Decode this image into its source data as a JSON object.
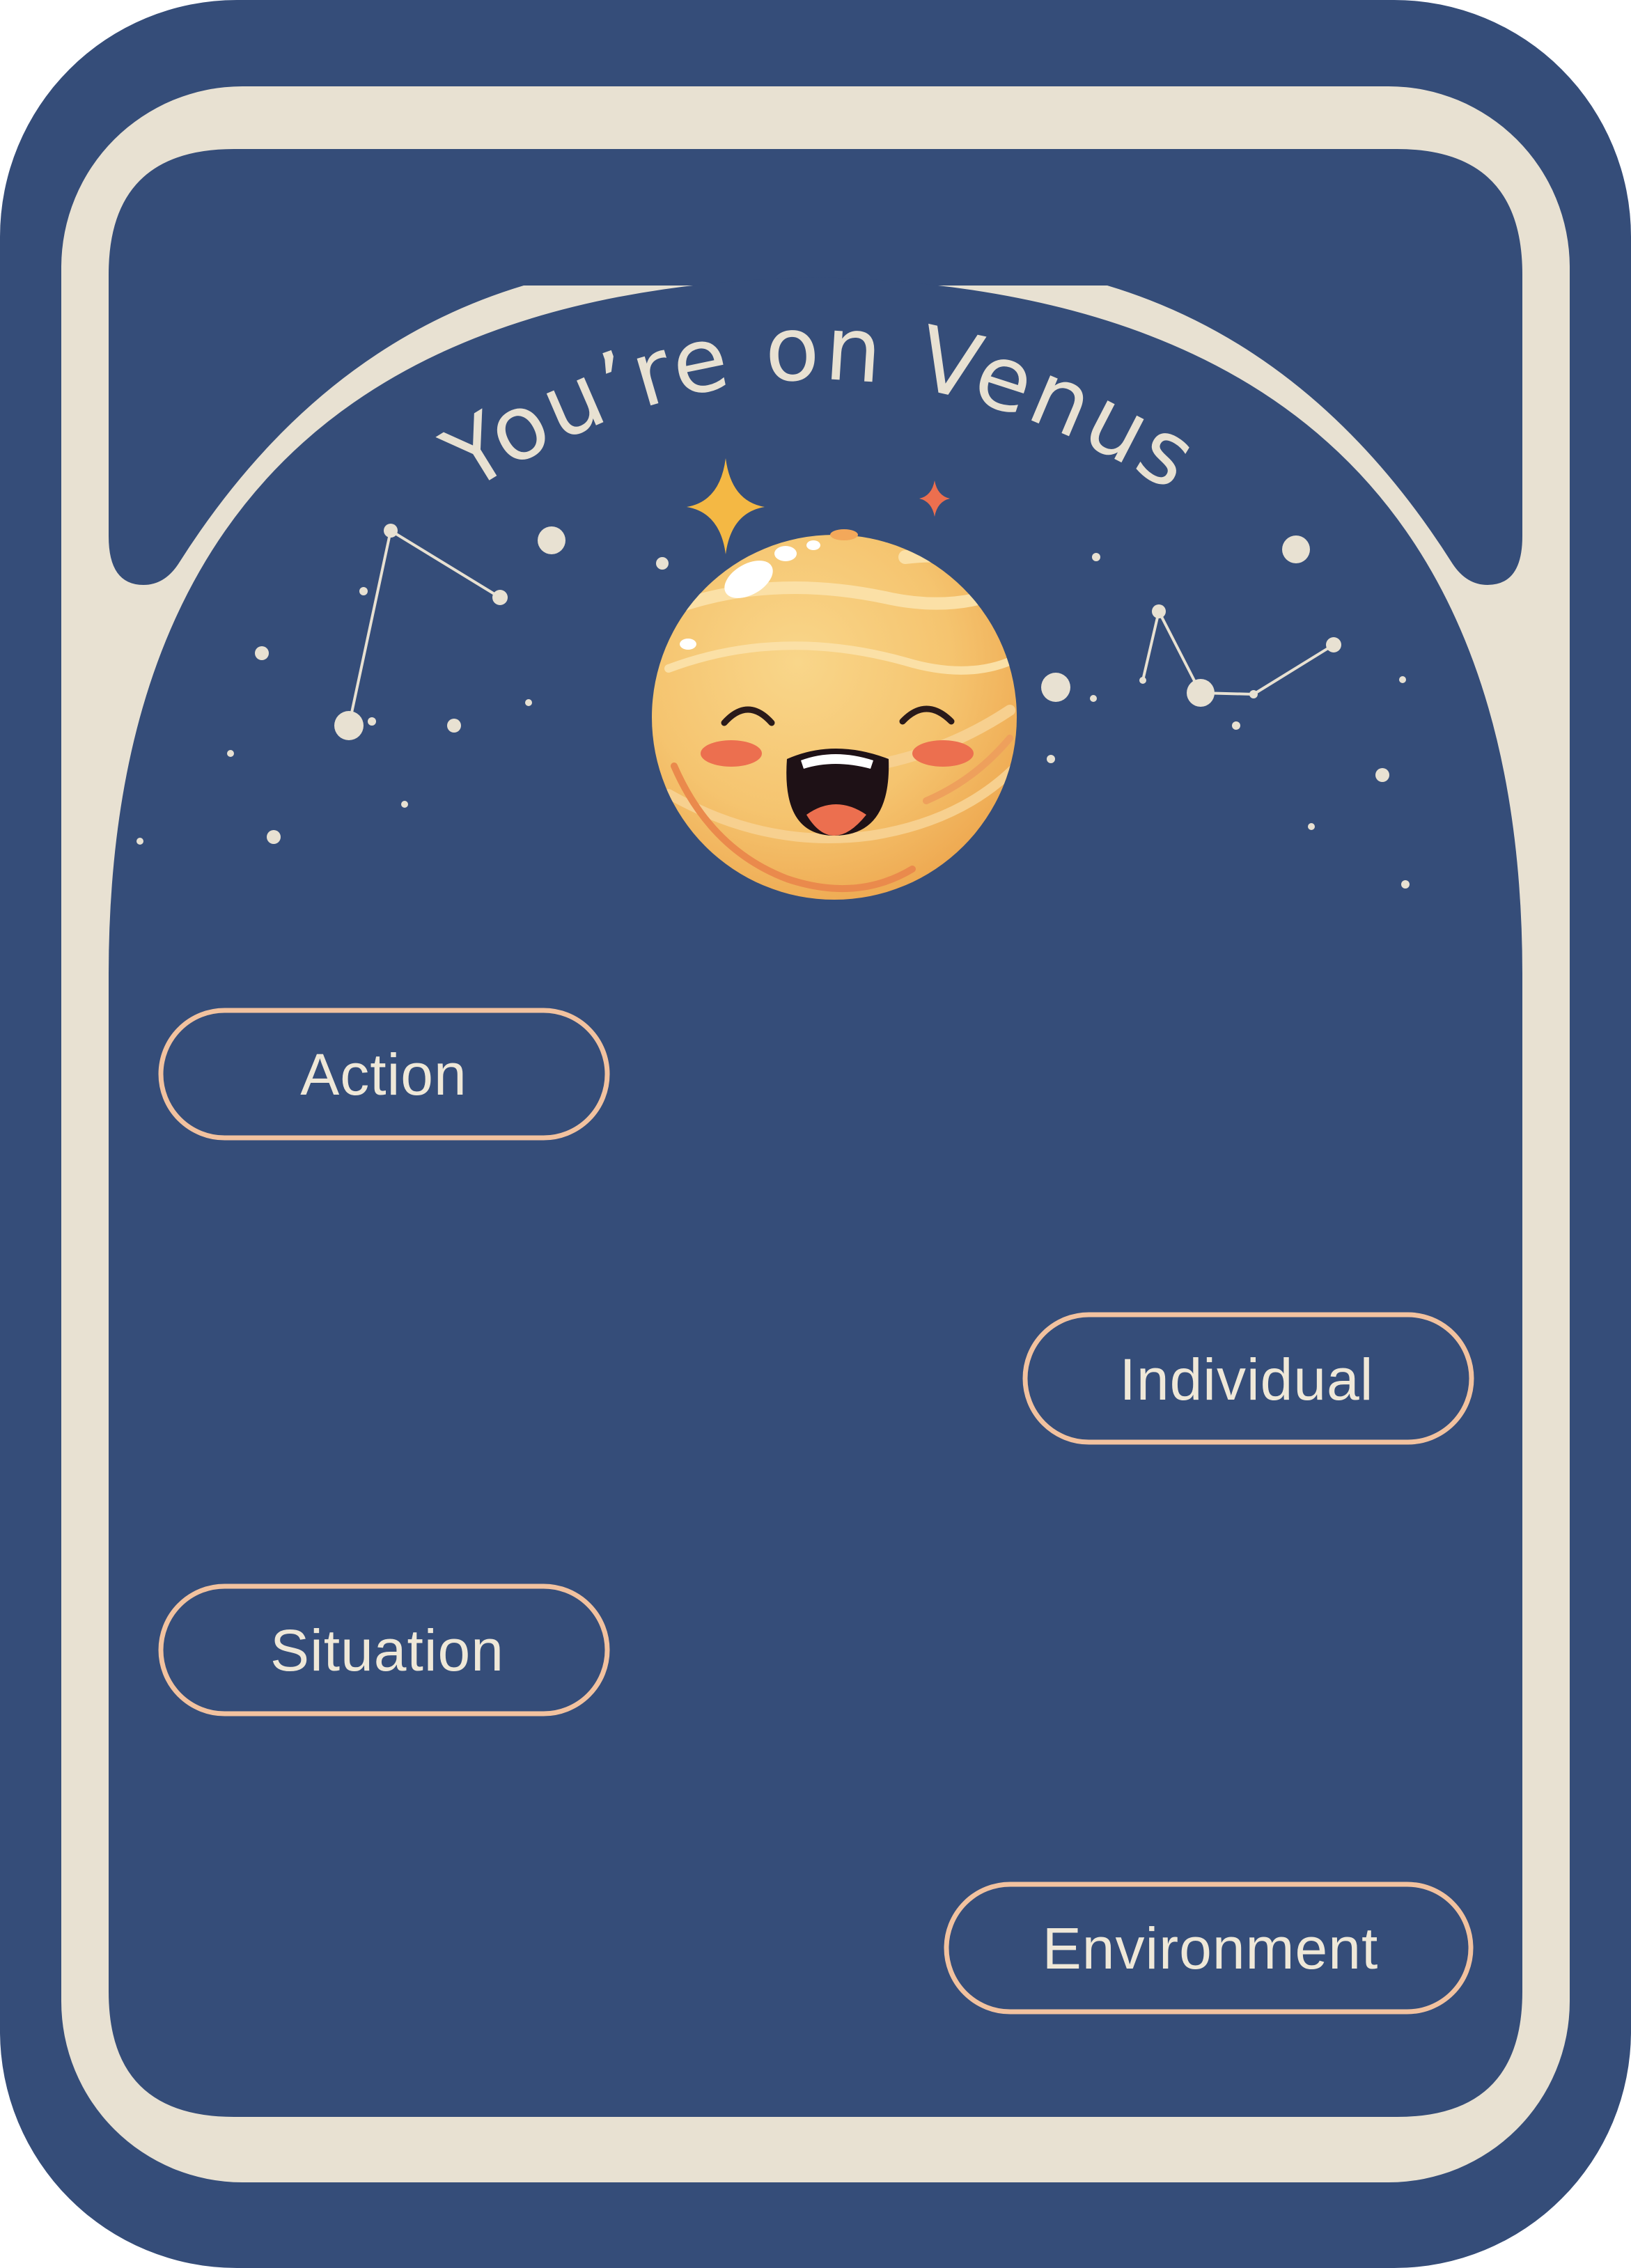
{
  "card": {
    "title": "You’re on Venus",
    "colors": {
      "background": "#354d79",
      "frame": "#e8e1d2",
      "pill_border": "#f2c29f",
      "pill_text": "#efe8d8",
      "planet": "#f5c46f",
      "cheeks": "#ec6f4f",
      "stars": "#e8e1d2"
    },
    "illustration": {
      "name": "smiling-venus-planet",
      "icon": "planet-icon"
    }
  },
  "categories": [
    {
      "label": "Action"
    },
    {
      "label": "Individual"
    },
    {
      "label": "Situation"
    },
    {
      "label": "Environment"
    }
  ]
}
